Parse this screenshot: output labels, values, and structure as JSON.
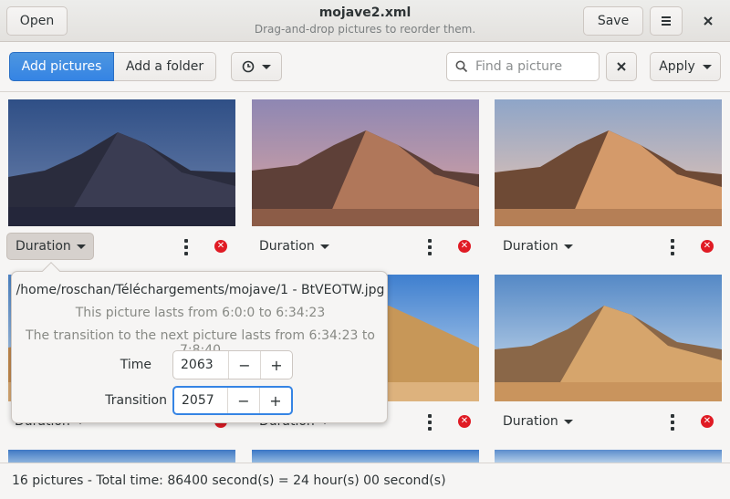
{
  "header": {
    "open_label": "Open",
    "title": "mojave2.xml",
    "subtitle": "Drag-and-drop pictures to reorder them.",
    "save_label": "Save",
    "menu_icon": "hamburger-menu-icon",
    "close_icon": "close-icon"
  },
  "toolbar": {
    "add_pictures_label": "Add pictures",
    "add_folder_label": "Add a folder",
    "clock_icon": "clock-icon",
    "search_placeholder": "Find a picture",
    "apply_label": "Apply"
  },
  "grid": {
    "items": [
      {
        "duration_label": "Duration",
        "palette": "night"
      },
      {
        "duration_label": "Duration",
        "palette": "dusk"
      },
      {
        "duration_label": "Duration",
        "palette": "sunset"
      },
      {
        "duration_label": "Duration",
        "palette": "day"
      },
      {
        "duration_label": "Duration",
        "palette": "day"
      },
      {
        "duration_label": "Duration",
        "palette": "day"
      }
    ]
  },
  "popover": {
    "path": "/home/roschan/Téléchargements/mojave/1 - BtVEOTW.jpg",
    "lasts_text": "This picture lasts from 6:0:0 to 6:34:23",
    "transition_text": "The transition to the next picture lasts from 6:34:23 to 7:8:40",
    "time_label": "Time",
    "time_value": "2063",
    "transition_label": "Transition",
    "transition_value": "2057",
    "minus": "−",
    "plus": "+"
  },
  "status": {
    "text": "16 pictures - Total time: 86400 second(s) = 24 hour(s) 00 second(s)"
  },
  "colors": {
    "accent": "#3584e4",
    "remove": "#e01b24"
  }
}
